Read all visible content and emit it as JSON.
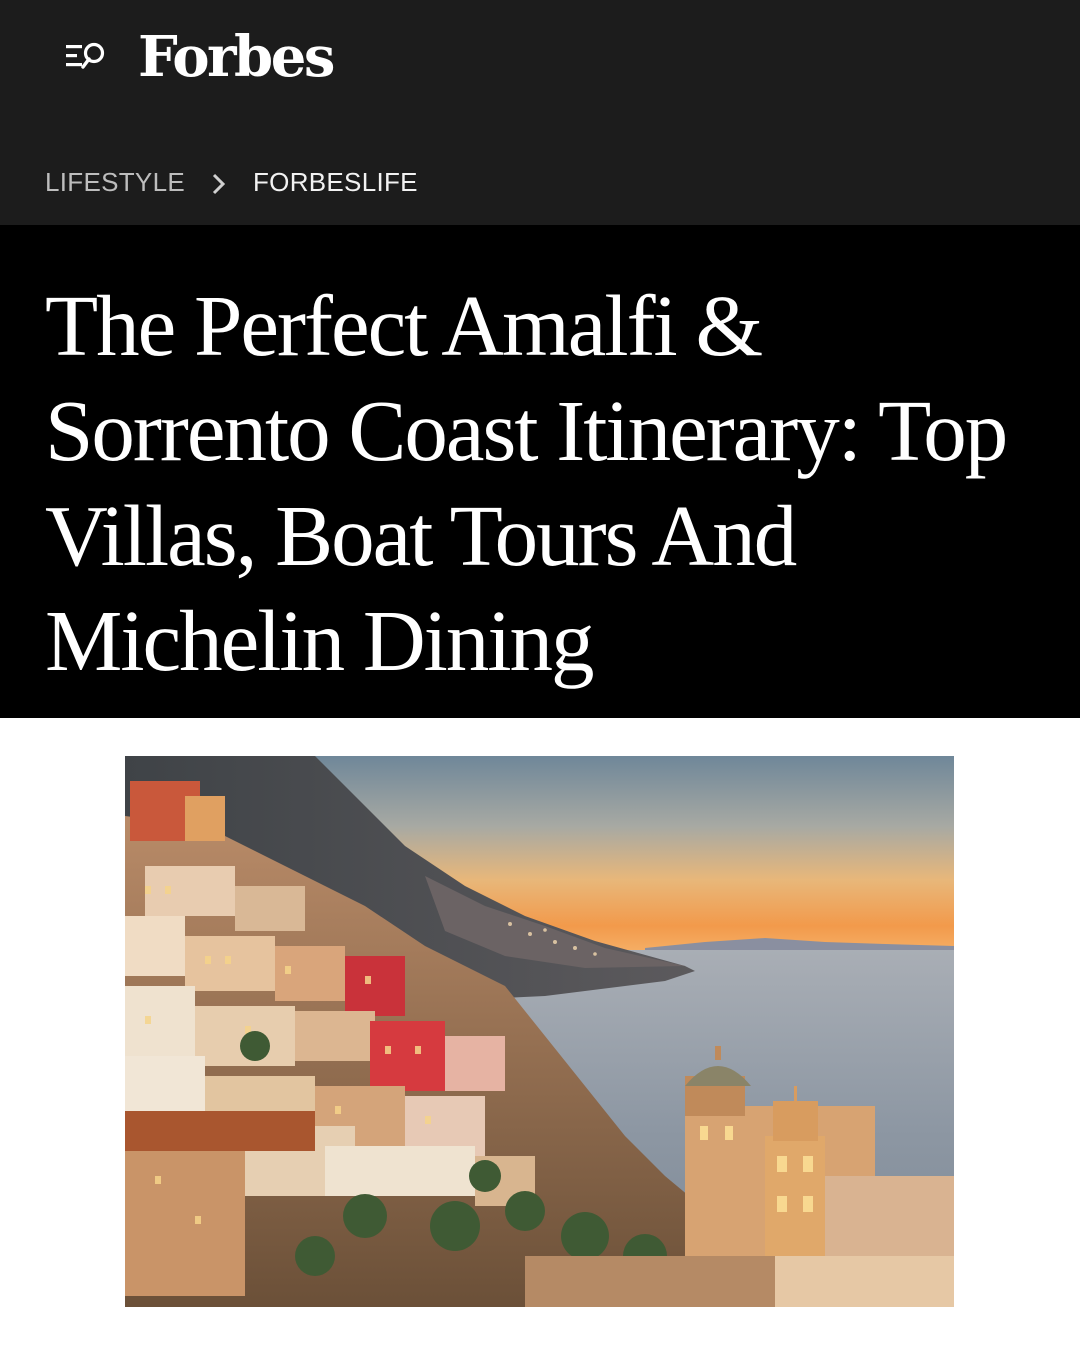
{
  "header": {
    "logo": "Forbes",
    "menu_icon": "menu-search-icon",
    "background": "#1c1c1c"
  },
  "breadcrumb": {
    "items": [
      {
        "label": "LIFESTYLE"
      },
      {
        "label": "FORBESLIFE"
      }
    ],
    "separator_icon": "chevron-right-icon"
  },
  "article": {
    "headline": "The Perfect Amalfi & Sorrento Coast Itinerary: Top Villas, Boat Tours And Michelin Dining",
    "background": "#000000"
  },
  "hero_image": {
    "subject": "positano-cliffside-town-at-sunset-photo"
  }
}
